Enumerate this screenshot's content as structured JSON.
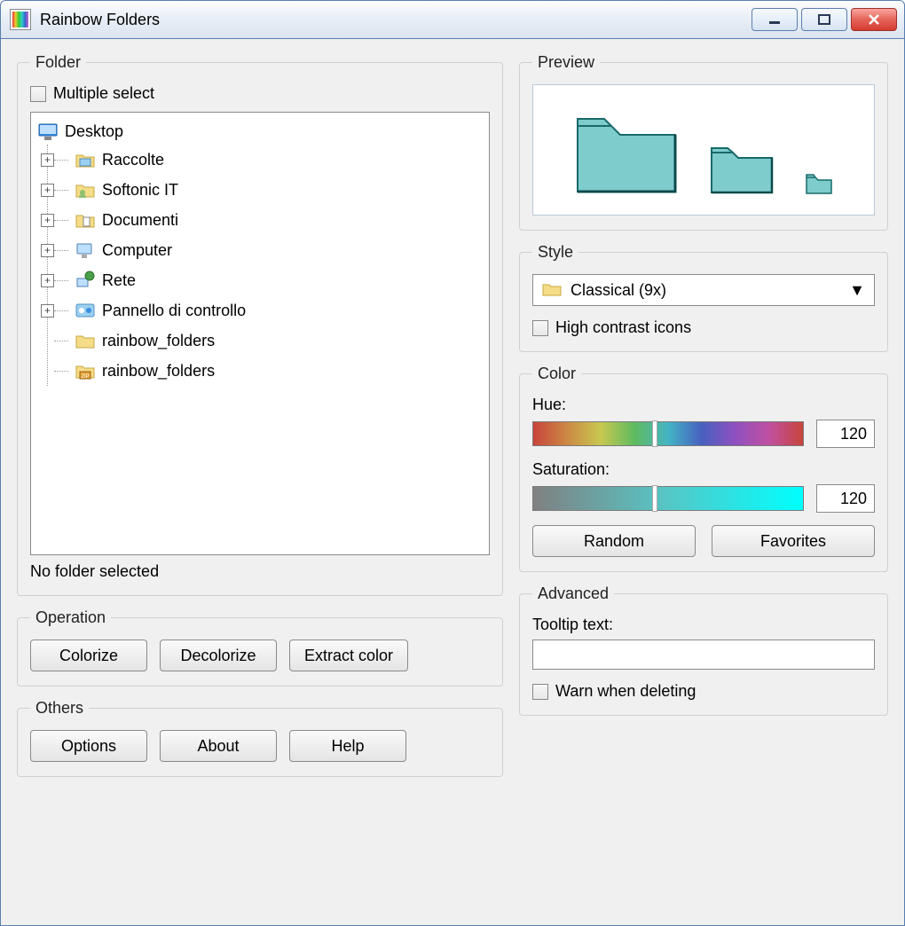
{
  "window": {
    "title": "Rainbow Folders"
  },
  "folder_group": {
    "legend": "Folder",
    "multiple_select_label": "Multiple select",
    "tree": {
      "root": "Desktop",
      "items": [
        {
          "label": "Raccolte",
          "expandable": true,
          "icon": "folder-blue"
        },
        {
          "label": "Softonic IT",
          "expandable": true,
          "icon": "folder-user"
        },
        {
          "label": "Documenti",
          "expandable": true,
          "icon": "folder-doc"
        },
        {
          "label": "Computer",
          "expandable": true,
          "icon": "computer"
        },
        {
          "label": "Rete",
          "expandable": true,
          "icon": "network"
        },
        {
          "label": "Pannello di controllo",
          "expandable": true,
          "icon": "control-panel"
        },
        {
          "label": "rainbow_folders",
          "expandable": false,
          "icon": "folder-y"
        },
        {
          "label": "rainbow_folders",
          "expandable": false,
          "icon": "zip"
        }
      ]
    },
    "status": "No folder selected"
  },
  "operation": {
    "legend": "Operation",
    "colorize": "Colorize",
    "decolorize": "Decolorize",
    "extract": "Extract color"
  },
  "others": {
    "legend": "Others",
    "options": "Options",
    "about": "About",
    "help": "Help"
  },
  "preview": {
    "legend": "Preview",
    "folder_color": "#7fcccc"
  },
  "style": {
    "legend": "Style",
    "selected": "Classical (9x)",
    "high_contrast": "High contrast icons"
  },
  "color": {
    "legend": "Color",
    "hue_label": "Hue:",
    "hue_value": "120",
    "sat_label": "Saturation:",
    "sat_value": "120",
    "random": "Random",
    "favorites": "Favorites"
  },
  "advanced": {
    "legend": "Advanced",
    "tooltip_label": "Tooltip text:",
    "tooltip_value": "",
    "warn_label": "Warn when deleting"
  }
}
